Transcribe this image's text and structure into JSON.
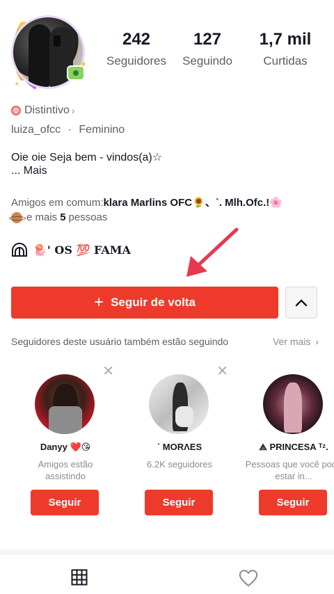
{
  "profile": {
    "username": "luiza_ofcc",
    "gender": "Feminino",
    "separator": "·",
    "badge_label": "Distintivo",
    "bio": "Oie oie Seja bem - vindos(a)☆",
    "bio_more": "...  Mais"
  },
  "stats": [
    {
      "value": "242",
      "label": "Seguidores"
    },
    {
      "value": "127",
      "label": "Seguindo"
    },
    {
      "value": "1,7 mil",
      "label": "Curtidas"
    }
  ],
  "mutual": {
    "prefix": "Amigos em comum:",
    "names": "klara Marlins OFC🌻、`. Mlh.Ofc.!🌸",
    "and_more": "e mais",
    "count": "5",
    "people": "pessoas"
  },
  "link_row": {
    "text": "🪼' OS 💯 FAMA"
  },
  "actions": {
    "follow_back": "Seguir de volta",
    "plus_glyph": "+"
  },
  "suggestions": {
    "header": "Seguidores deste usuário também estão seguindo",
    "see_more": "Ver mais",
    "cards": [
      {
        "name": "Danyy ❤️😘",
        "sub": "Amigos estão assistindo",
        "button": "Seguir"
      },
      {
        "name": "`    MORΛES",
        "sub": "6.2K seguidores",
        "button": "Seguir"
      },
      {
        "name": "⟁ PRINCESA ᵀᶻ.",
        "sub": "Pessoas que você pode estar in...",
        "button": "Seguir"
      }
    ]
  },
  "icons": {
    "badge": "badge-icon",
    "chevron": "chevron-right-icon",
    "link": "link-icon",
    "expand": "chevron-up-icon",
    "grid": "grid-icon",
    "heart": "heart-icon",
    "close": "close-icon",
    "arrow": "red-annotation-arrow"
  },
  "colors": {
    "primary": "#ee3a2b",
    "text": "#161823",
    "muted": "#5c5d64"
  }
}
